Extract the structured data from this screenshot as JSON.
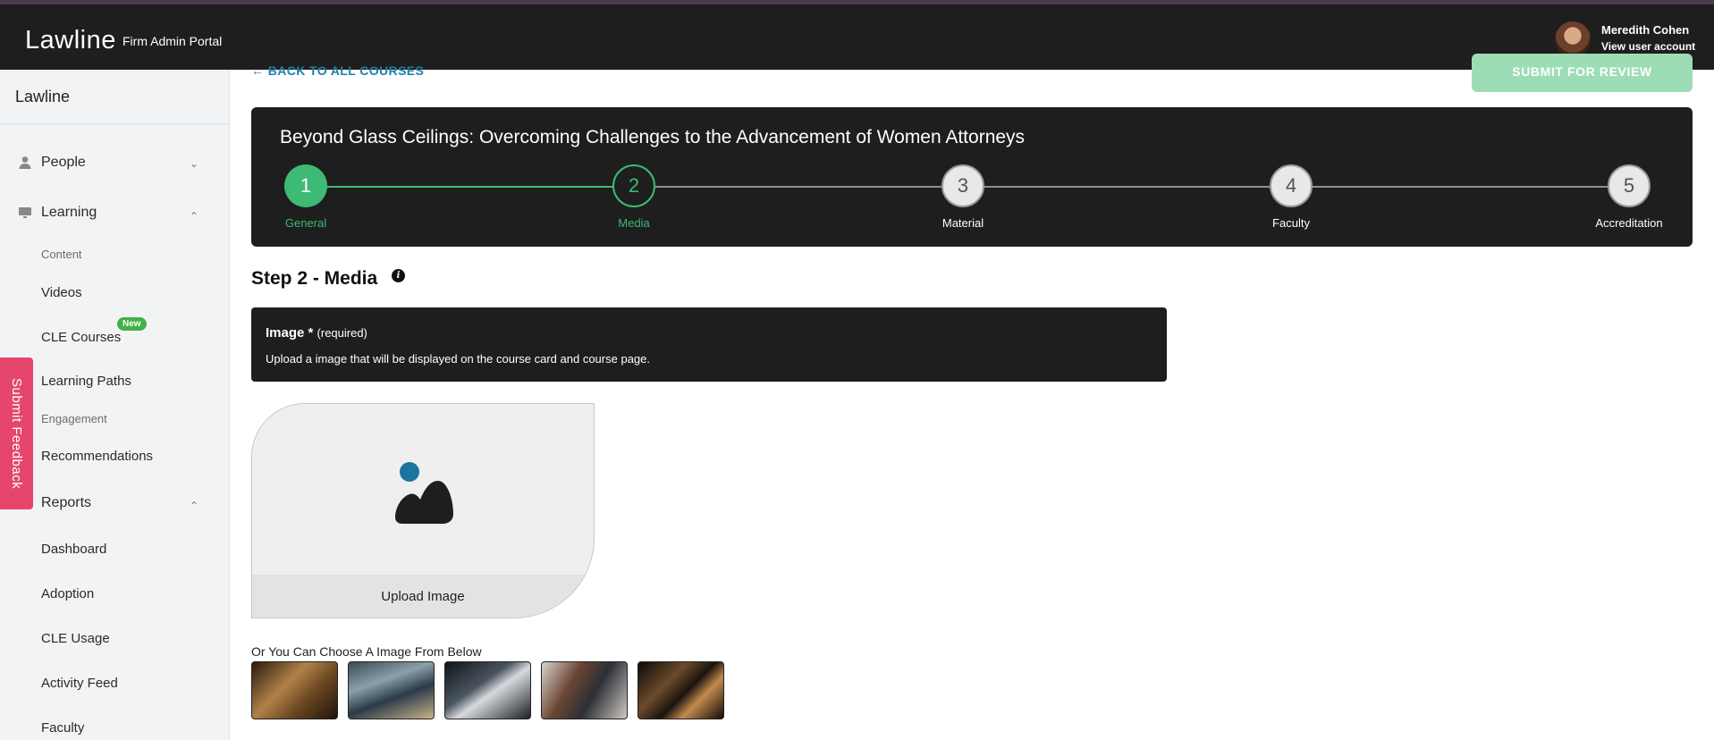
{
  "topbar": {
    "logo": "Lawline",
    "portal": "Firm Admin Portal",
    "user_name": "Meredith Cohen",
    "user_account_link": "View user account"
  },
  "sidebar": {
    "brand": "Lawline",
    "sections": {
      "people": "People",
      "learning": "Learning",
      "reports": "Reports"
    },
    "learning_groups": {
      "content": "Content",
      "engagement": "Engagement"
    },
    "learning_items": {
      "videos": "Videos",
      "cle_courses": "CLE Courses",
      "learning_paths": "Learning Paths",
      "recommendations": "Recommendations"
    },
    "new_badge": "New",
    "report_items": {
      "dashboard": "Dashboard",
      "adoption": "Adoption",
      "cle_usage": "CLE Usage",
      "activity_feed": "Activity Feed",
      "faculty": "Faculty"
    }
  },
  "feedback_tab": "Submit Feedback",
  "main": {
    "back_link": "BACK TO ALL COURSES",
    "submit_button": "SUBMIT FOR REVIEW",
    "course_title": "Beyond Glass Ceilings: Overcoming Challenges to the Advancement of Women Attorneys",
    "steps": [
      {
        "number": "1",
        "label": "General",
        "state": "completed"
      },
      {
        "number": "2",
        "label": "Media",
        "state": "current"
      },
      {
        "number": "3",
        "label": "Material",
        "state": "pending"
      },
      {
        "number": "4",
        "label": "Faculty",
        "state": "pending"
      },
      {
        "number": "5",
        "label": "Accreditation",
        "state": "pending"
      }
    ],
    "step_heading": "Step 2 - Media",
    "image_section": {
      "title": "Image *",
      "required": "(required)",
      "description": "Upload a image that will be displayed on the course card and course page."
    },
    "upload_label": "Upload Image",
    "choose_text": "Or You Can Choose A Image From Below"
  },
  "colors": {
    "accent_green": "#3dba73",
    "link_blue": "#1c7fa8",
    "feedback_pink": "#e6456c",
    "dark_panel": "#1e1e1e"
  }
}
